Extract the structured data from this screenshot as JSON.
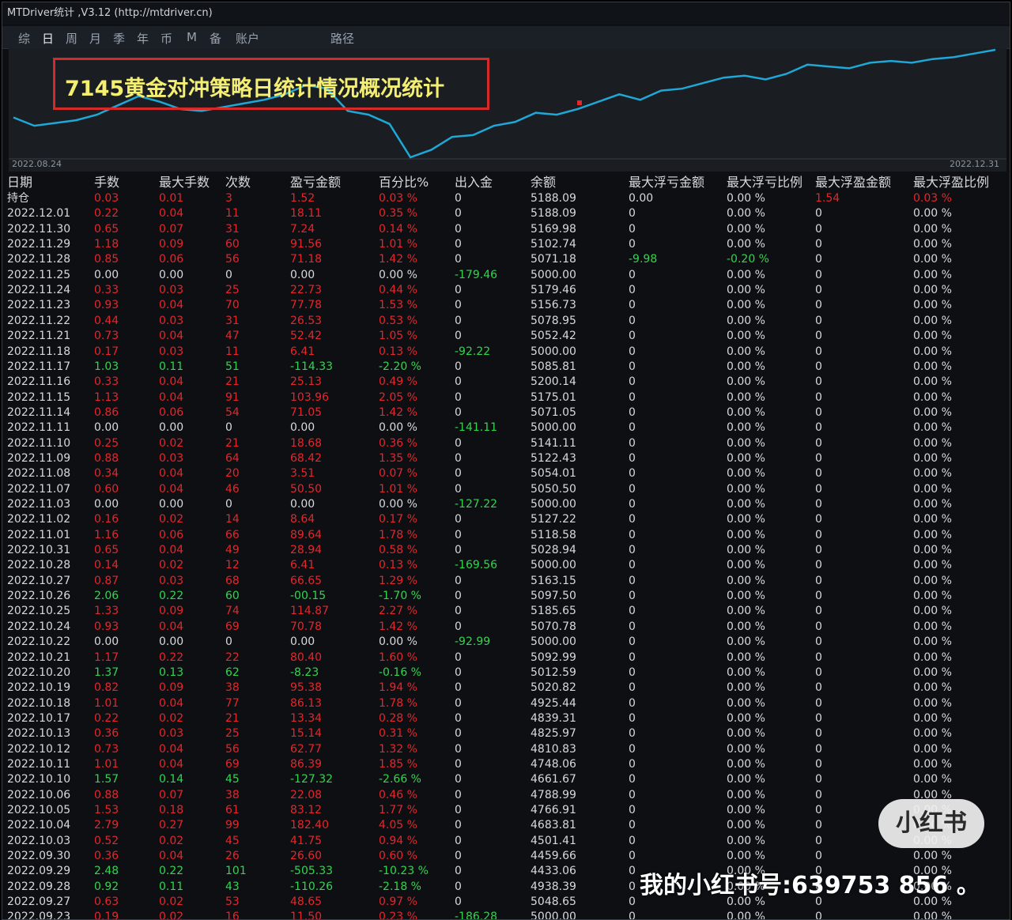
{
  "window": {
    "title": "MTDriver统计 ,V3.12 (http://mtdriver.cn)"
  },
  "menu": [
    {
      "label": "综",
      "active": false
    },
    {
      "label": "日",
      "active": true
    },
    {
      "label": "周",
      "active": false
    },
    {
      "label": "月",
      "active": false
    },
    {
      "label": "季",
      "active": false
    },
    {
      "label": "年",
      "active": false
    },
    {
      "label": "币",
      "active": false
    },
    {
      "label": "M",
      "active": false
    },
    {
      "label": "备",
      "active": false
    },
    {
      "label": "账户",
      "active": false
    },
    {
      "label": "路径",
      "active": false
    }
  ],
  "chart": {
    "annotation": "7145黄金对冲策略日统计情况概况统计",
    "start_date": "2022.08.24",
    "end_date": "2022.12.31",
    "line_color": "#1fa7d6",
    "annotation_color": "#f4ee72",
    "box_color": "#d42a2a"
  },
  "chart_data": {
    "type": "line",
    "x": [
      "2022.08.24",
      "2022.12.31"
    ],
    "series": [
      {
        "values": [
          5175,
          5130,
          5145,
          5160,
          5190,
          5240,
          5290,
          5260,
          5220,
          5210,
          5230,
          5250,
          5270,
          5300,
          5350,
          5330,
          5210,
          5190,
          5140,
          4960,
          5000,
          5070,
          5080,
          5130,
          5150,
          5200,
          5190,
          5220,
          5260,
          5300,
          5270,
          5320,
          5330,
          5360,
          5390,
          5400,
          5380,
          5410,
          5460,
          5450,
          5440,
          5470,
          5480,
          5470,
          5490,
          5500,
          5520,
          5540
        ]
      }
    ]
  },
  "table": {
    "headers": [
      "日期",
      "手数",
      "最大手数",
      "次数",
      "盈亏金额",
      "百分比%",
      "出入金",
      "余额",
      "最大浮亏金额",
      "最大浮亏比例",
      "最大浮盈金额",
      "最大浮盈比例"
    ],
    "rows": [
      [
        "持仓",
        "0.03",
        "0.01",
        "3",
        "1.52",
        "0.03 %",
        "0",
        "5188.09",
        "0.00",
        "0.00 %",
        "1.54",
        "0.03 %"
      ],
      [
        "2022.12.01",
        "0.22",
        "0.04",
        "11",
        "18.11",
        "0.35 %",
        "0",
        "5188.09",
        "0",
        "0.00 %",
        "0",
        "0.00 %"
      ],
      [
        "2022.11.30",
        "0.65",
        "0.07",
        "31",
        "7.24",
        "0.14 %",
        "0",
        "5169.98",
        "0",
        "0.00 %",
        "0",
        "0.00 %"
      ],
      [
        "2022.11.29",
        "1.18",
        "0.09",
        "60",
        "91.56",
        "1.01 %",
        "0",
        "5102.74",
        "0",
        "0.00 %",
        "0",
        "0.00 %"
      ],
      [
        "2022.11.28",
        "0.85",
        "0.06",
        "56",
        "71.18",
        "1.42 %",
        "0",
        "5071.18",
        "-9.98",
        "-0.20 %",
        "0",
        "0.00 %"
      ],
      [
        "2022.11.25",
        "0.00",
        "0.00",
        "0",
        "0.00",
        "0.00 %",
        "-179.46",
        "5000.00",
        "0",
        "0.00 %",
        "0",
        "0.00 %"
      ],
      [
        "2022.11.24",
        "0.33",
        "0.03",
        "25",
        "22.73",
        "0.44 %",
        "0",
        "5179.46",
        "0",
        "0.00 %",
        "0",
        "0.00 %"
      ],
      [
        "2022.11.23",
        "0.93",
        "0.04",
        "70",
        "77.78",
        "1.53 %",
        "0",
        "5156.73",
        "0",
        "0.00 %",
        "0",
        "0.00 %"
      ],
      [
        "2022.11.22",
        "0.44",
        "0.03",
        "31",
        "26.53",
        "0.53 %",
        "0",
        "5078.95",
        "0",
        "0.00 %",
        "0",
        "0.00 %"
      ],
      [
        "2022.11.21",
        "0.73",
        "0.04",
        "47",
        "52.42",
        "1.05 %",
        "0",
        "5052.42",
        "0",
        "0.00 %",
        "0",
        "0.00 %"
      ],
      [
        "2022.11.18",
        "0.17",
        "0.03",
        "11",
        "6.41",
        "0.13 %",
        "-92.22",
        "5000.00",
        "0",
        "0.00 %",
        "0",
        "0.00 %"
      ],
      [
        "2022.11.17",
        "1.03",
        "0.11",
        "51",
        "-114.33",
        "-2.20 %",
        "0",
        "5085.81",
        "0",
        "0.00 %",
        "0",
        "0.00 %"
      ],
      [
        "2022.11.16",
        "0.33",
        "0.04",
        "21",
        "25.13",
        "0.49 %",
        "0",
        "5200.14",
        "0",
        "0.00 %",
        "0",
        "0.00 %"
      ],
      [
        "2022.11.15",
        "1.13",
        "0.04",
        "91",
        "103.96",
        "2.05 %",
        "0",
        "5175.01",
        "0",
        "0.00 %",
        "0",
        "0.00 %"
      ],
      [
        "2022.11.14",
        "0.86",
        "0.06",
        "54",
        "71.05",
        "1.42 %",
        "0",
        "5071.05",
        "0",
        "0.00 %",
        "0",
        "0.00 %"
      ],
      [
        "2022.11.11",
        "0.00",
        "0.00",
        "0",
        "0.00",
        "0.00 %",
        "-141.11",
        "5000.00",
        "0",
        "0.00 %",
        "0",
        "0.00 %"
      ],
      [
        "2022.11.10",
        "0.25",
        "0.02",
        "21",
        "18.68",
        "0.36 %",
        "0",
        "5141.11",
        "0",
        "0.00 %",
        "0",
        "0.00 %"
      ],
      [
        "2022.11.09",
        "0.88",
        "0.03",
        "64",
        "68.42",
        "1.35 %",
        "0",
        "5122.43",
        "0",
        "0.00 %",
        "0",
        "0.00 %"
      ],
      [
        "2022.11.08",
        "0.34",
        "0.04",
        "20",
        "3.51",
        "0.07 %",
        "0",
        "5054.01",
        "0",
        "0.00 %",
        "0",
        "0.00 %"
      ],
      [
        "2022.11.07",
        "0.60",
        "0.04",
        "46",
        "50.50",
        "1.01 %",
        "0",
        "5050.50",
        "0",
        "0.00 %",
        "0",
        "0.00 %"
      ],
      [
        "2022.11.03",
        "0.00",
        "0.00",
        "0",
        "0.00",
        "0.00 %",
        "-127.22",
        "5000.00",
        "0",
        "0.00 %",
        "0",
        "0.00 %"
      ],
      [
        "2022.11.02",
        "0.16",
        "0.02",
        "14",
        "8.64",
        "0.17 %",
        "0",
        "5127.22",
        "0",
        "0.00 %",
        "0",
        "0.00 %"
      ],
      [
        "2022.11.01",
        "1.16",
        "0.06",
        "66",
        "89.64",
        "1.78 %",
        "0",
        "5118.58",
        "0",
        "0.00 %",
        "0",
        "0.00 %"
      ],
      [
        "2022.10.31",
        "0.65",
        "0.04",
        "49",
        "28.94",
        "0.58 %",
        "0",
        "5028.94",
        "0",
        "0.00 %",
        "0",
        "0.00 %"
      ],
      [
        "2022.10.28",
        "0.14",
        "0.02",
        "12",
        "6.41",
        "0.13 %",
        "-169.56",
        "5000.00",
        "0",
        "0.00 %",
        "0",
        "0.00 %"
      ],
      [
        "2022.10.27",
        "0.87",
        "0.03",
        "68",
        "66.65",
        "1.29 %",
        "0",
        "5163.15",
        "0",
        "0.00 %",
        "0",
        "0.00 %"
      ],
      [
        "2022.10.26",
        "2.06",
        "0.22",
        "60",
        "-00.15",
        "-1.70 %",
        "0",
        "5097.50",
        "0",
        "0.00 %",
        "0",
        "0.00 %"
      ],
      [
        "2022.10.25",
        "1.33",
        "0.09",
        "74",
        "114.87",
        "2.27 %",
        "0",
        "5185.65",
        "0",
        "0.00 %",
        "0",
        "0.00 %"
      ],
      [
        "2022.10.24",
        "0.93",
        "0.04",
        "69",
        "70.78",
        "1.42 %",
        "0",
        "5070.78",
        "0",
        "0.00 %",
        "0",
        "0.00 %"
      ],
      [
        "2022.10.22",
        "0.00",
        "0.00",
        "0",
        "0.00",
        "0.00 %",
        "-92.99",
        "5000.00",
        "0",
        "0.00 %",
        "0",
        "0.00 %"
      ],
      [
        "2022.10.21",
        "1.17",
        "0.22",
        "22",
        "80.40",
        "1.60 %",
        "0",
        "5092.99",
        "0",
        "0.00 %",
        "0",
        "0.00 %"
      ],
      [
        "2022.10.20",
        "1.37",
        "0.13",
        "62",
        "-8.23",
        "-0.16 %",
        "0",
        "5012.59",
        "0",
        "0.00 %",
        "0",
        "0.00 %"
      ],
      [
        "2022.10.19",
        "0.82",
        "0.09",
        "38",
        "95.38",
        "1.94 %",
        "0",
        "5020.82",
        "0",
        "0.00 %",
        "0",
        "0.00 %"
      ],
      [
        "2022.10.18",
        "1.01",
        "0.04",
        "77",
        "86.13",
        "1.78 %",
        "0",
        "4925.44",
        "0",
        "0.00 %",
        "0",
        "0.00 %"
      ],
      [
        "2022.10.17",
        "0.22",
        "0.02",
        "21",
        "13.34",
        "0.28 %",
        "0",
        "4839.31",
        "0",
        "0.00 %",
        "0",
        "0.00 %"
      ],
      [
        "2022.10.13",
        "0.36",
        "0.03",
        "25",
        "15.14",
        "0.31 %",
        "0",
        "4825.97",
        "0",
        "0.00 %",
        "0",
        "0.00 %"
      ],
      [
        "2022.10.12",
        "0.73",
        "0.04",
        "56",
        "62.77",
        "1.32 %",
        "0",
        "4810.83",
        "0",
        "0.00 %",
        "0",
        "0.00 %"
      ],
      [
        "2022.10.11",
        "1.01",
        "0.04",
        "69",
        "86.39",
        "1.85 %",
        "0",
        "4748.06",
        "0",
        "0.00 %",
        "0",
        "0.00 %"
      ],
      [
        "2022.10.10",
        "1.57",
        "0.14",
        "45",
        "-127.32",
        "-2.66 %",
        "0",
        "4661.67",
        "0",
        "0.00 %",
        "0",
        "0.00 %"
      ],
      [
        "2022.10.06",
        "0.88",
        "0.07",
        "38",
        "22.08",
        "0.46 %",
        "0",
        "4788.99",
        "0",
        "0.00 %",
        "0",
        "0.00 %"
      ],
      [
        "2022.10.05",
        "1.53",
        "0.18",
        "61",
        "83.12",
        "1.77 %",
        "0",
        "4766.91",
        "0",
        "0.00 %",
        "0",
        "0.00 %"
      ],
      [
        "2022.10.04",
        "2.79",
        "0.27",
        "99",
        "182.40",
        "4.05 %",
        "0",
        "4683.81",
        "0",
        "0.00 %",
        "0",
        "0.00 %"
      ],
      [
        "2022.10.03",
        "0.52",
        "0.02",
        "45",
        "41.75",
        "0.94 %",
        "0",
        "4501.41",
        "0",
        "0.00 %",
        "0",
        "0.00 %"
      ],
      [
        "2022.09.30",
        "0.36",
        "0.04",
        "26",
        "26.60",
        "0.60 %",
        "0",
        "4459.66",
        "0",
        "0.00 %",
        "0",
        "0.00 %"
      ],
      [
        "2022.09.29",
        "2.48",
        "0.22",
        "101",
        "-505.33",
        "-10.23 %",
        "0",
        "4433.06",
        "0",
        "0.00 %",
        "0",
        "0.00 %"
      ],
      [
        "2022.09.28",
        "0.92",
        "0.11",
        "43",
        "-110.26",
        "-2.18 %",
        "0",
        "4938.39",
        "0",
        "0.00 %",
        "0",
        "0.00 %"
      ],
      [
        "2022.09.27",
        "0.63",
        "0.02",
        "53",
        "48.65",
        "0.97 %",
        "0",
        "5048.65",
        "0",
        "0.00 %",
        "0",
        "0.00 %"
      ],
      [
        "2022.09.23",
        "0.19",
        "0.02",
        "16",
        "11.50",
        "0.23 %",
        "-186.28",
        "5000.00",
        "0",
        "0.00 %",
        "0",
        "0.00 %"
      ]
    ]
  },
  "watermark": {
    "logo": "小红书",
    "text": "我的小红书号:639753 856 。"
  }
}
